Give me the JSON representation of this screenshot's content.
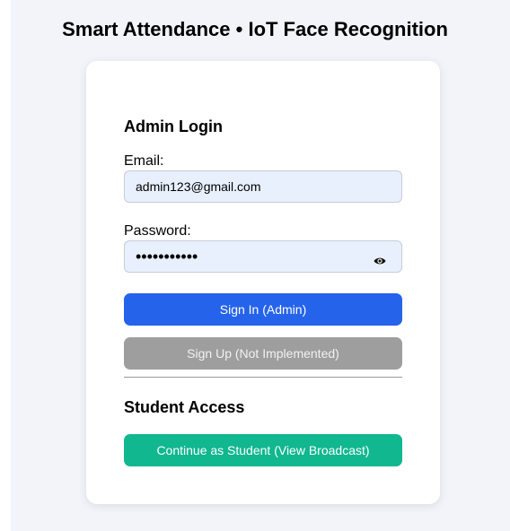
{
  "app": {
    "title": "Smart Attendance • IoT Face Recognition"
  },
  "admin": {
    "heading": "Admin Login",
    "email_label": "Email:",
    "email_value": "admin123@gmail.com",
    "password_label": "Password:",
    "password_value": "•••••••••••",
    "sign_in_label": "Sign In (Admin)",
    "sign_up_label": "Sign Up (Not Implemented)"
  },
  "student": {
    "heading": "Student Access",
    "continue_label": "Continue as Student (View Broadcast)"
  },
  "icons": {
    "password_toggle": "eye-icon"
  },
  "colors": {
    "primary": "#2563eb",
    "disabled": "#9e9e9e",
    "student": "#10b78f",
    "input_bg": "#e8f0fe",
    "page_bg": "#f3f4f9"
  }
}
